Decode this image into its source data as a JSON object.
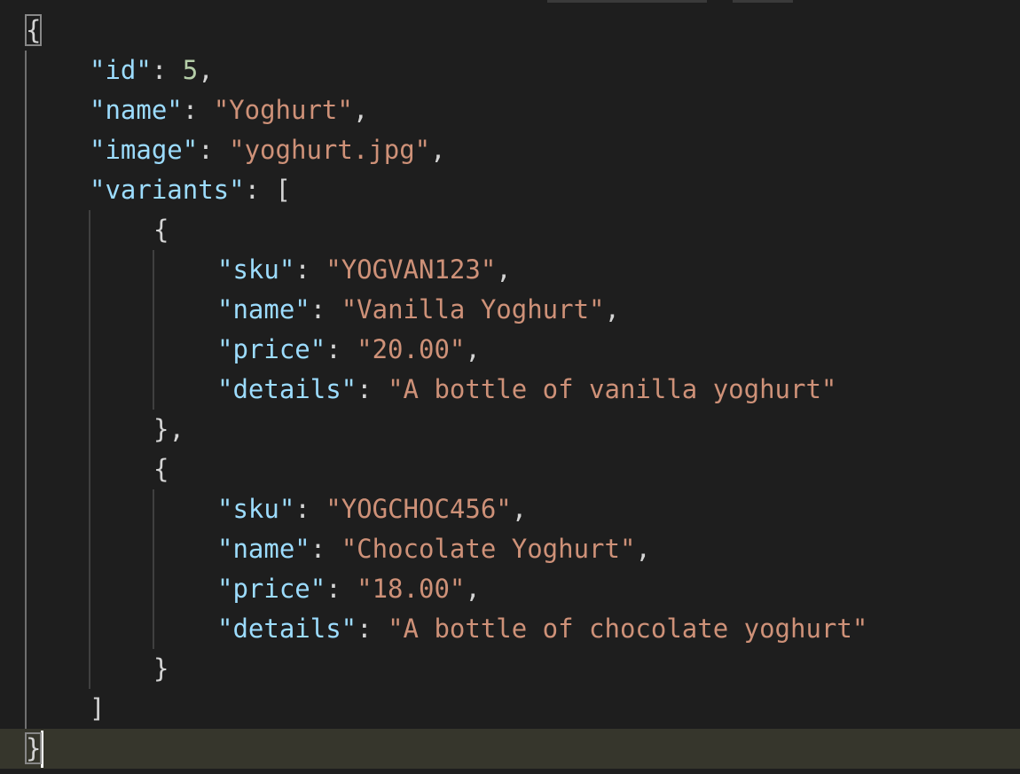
{
  "editor": {
    "theme": {
      "background": "#1e1e1e",
      "key_color": "#9cdcfe",
      "string_color": "#ce9178",
      "number_color": "#b5cea8",
      "punctuation_color": "#d4d4d4",
      "current_line_color": "#36362c"
    },
    "lines": [
      {
        "open": "{"
      },
      {
        "key": "\"id\"",
        "sep": ": ",
        "num": "5",
        "trail": ","
      },
      {
        "key": "\"name\"",
        "sep": ": ",
        "str": "\"Yoghurt\"",
        "trail": ","
      },
      {
        "key": "\"image\"",
        "sep": ": ",
        "str": "\"yoghurt.jpg\"",
        "trail": ","
      },
      {
        "key": "\"variants\"",
        "sep": ": ",
        "punc": "["
      },
      {
        "punc": "{"
      },
      {
        "key": "\"sku\"",
        "sep": ": ",
        "str": "\"YOGVAN123\"",
        "trail": ","
      },
      {
        "key": "\"name\"",
        "sep": ": ",
        "str": "\"Vanilla Yoghurt\"",
        "trail": ","
      },
      {
        "key": "\"price\"",
        "sep": ": ",
        "str": "\"20.00\"",
        "trail": ","
      },
      {
        "key": "\"details\"",
        "sep": ": ",
        "str": "\"A bottle of vanilla yoghurt\""
      },
      {
        "punc": "},"
      },
      {
        "punc": "{"
      },
      {
        "key": "\"sku\"",
        "sep": ": ",
        "str": "\"YOGCHOC456\"",
        "trail": ","
      },
      {
        "key": "\"name\"",
        "sep": ": ",
        "str": "\"Chocolate Yoghurt\"",
        "trail": ","
      },
      {
        "key": "\"price\"",
        "sep": ": ",
        "str": "\"18.00\"",
        "trail": ","
      },
      {
        "key": "\"details\"",
        "sep": ": ",
        "str": "\"A bottle of chocolate yoghurt\""
      },
      {
        "punc": "}"
      },
      {
        "punc": "]"
      },
      {
        "close": "}"
      }
    ]
  }
}
